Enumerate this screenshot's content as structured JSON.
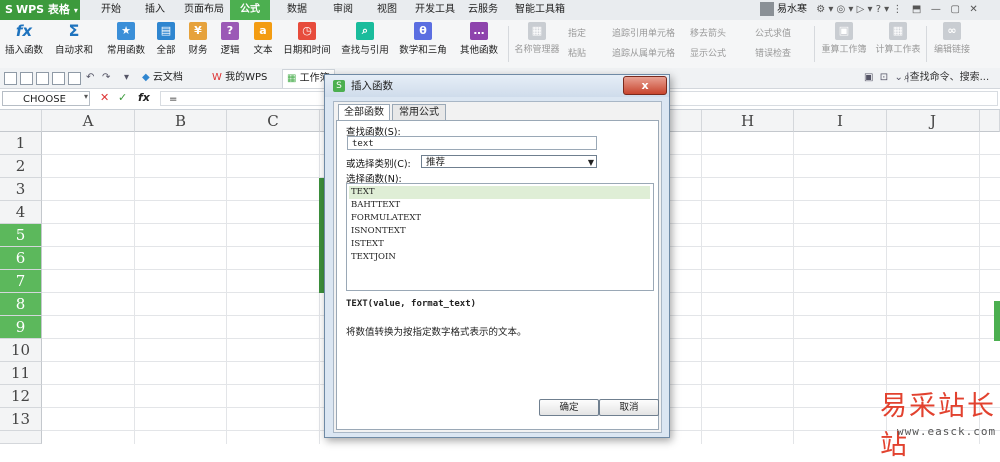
{
  "app": {
    "name": "WPS 表格"
  },
  "menu_tabs": [
    "开始",
    "插入",
    "页面布局",
    "公式",
    "数据",
    "审阅",
    "视图",
    "开发工具",
    "云服务",
    "智能工具箱"
  ],
  "active_tab": "公式",
  "user": {
    "name": "易水寒"
  },
  "ribbon": {
    "insert_function": "插入函数",
    "autosum": "自动求和",
    "common_functions": "常用函数",
    "all": "全部",
    "finance": "财务",
    "logic": "逻辑",
    "text": "文本",
    "datetime": "日期和时间",
    "lookup": "查找与引用",
    "math": "数学和三角",
    "other": "其他函数",
    "name_manager": "名称管理器",
    "specify": "指定",
    "paste": "粘贴",
    "trace_precedents": "追踪引用单元格",
    "trace_dependents": "追踪从属单元格",
    "remove_arrows": "移去箭头",
    "show_formulas": "显示公式",
    "formula_evaluate": "公式求值",
    "error_check": "错误检查",
    "recalc_workbook": "重算工作簿",
    "calc_sheet": "计算工作表",
    "edit_links": "编辑链接"
  },
  "toolbar": {
    "doc_tab_1": "云文档",
    "doc_tab_2": "我的WPS",
    "doc_tab_3": "工作簿",
    "search_placeholder": "查找命令、搜索..."
  },
  "formula_bar": {
    "name_box": "CHOOSE",
    "fx": "fx",
    "value": "="
  },
  "columns": [
    "A",
    "B",
    "C",
    "H",
    "I",
    "J"
  ],
  "rows": [
    "1",
    "2",
    "3",
    "4",
    "5",
    "6",
    "7",
    "8",
    "9",
    "10",
    "11",
    "12",
    "13"
  ],
  "dialog": {
    "title": "插入函数",
    "close": "x",
    "tab_all": "全部函数",
    "tab_common": "常用公式",
    "search_label": "查找函数(S):",
    "search_value": "text",
    "category_label": "或选择类别(C):",
    "category_value": "推荐",
    "select_label": "选择函数(N):",
    "functions": [
      "TEXT",
      "BAHTTEXT",
      "FORMULATEXT",
      "ISNONTEXT",
      "ISTEXT",
      "TEXTJOIN"
    ],
    "syntax": "TEXT(value, format_text)",
    "description": "将数值转换为按指定数字格式表示的文本。",
    "ok": "确定",
    "cancel": "取消"
  },
  "watermark": {
    "text": "易采站长站",
    "url": "www.easck.com"
  },
  "colors": {
    "accent": "#4caf50",
    "selected_row": "#5cb85c",
    "watermark": "#e2422f"
  }
}
